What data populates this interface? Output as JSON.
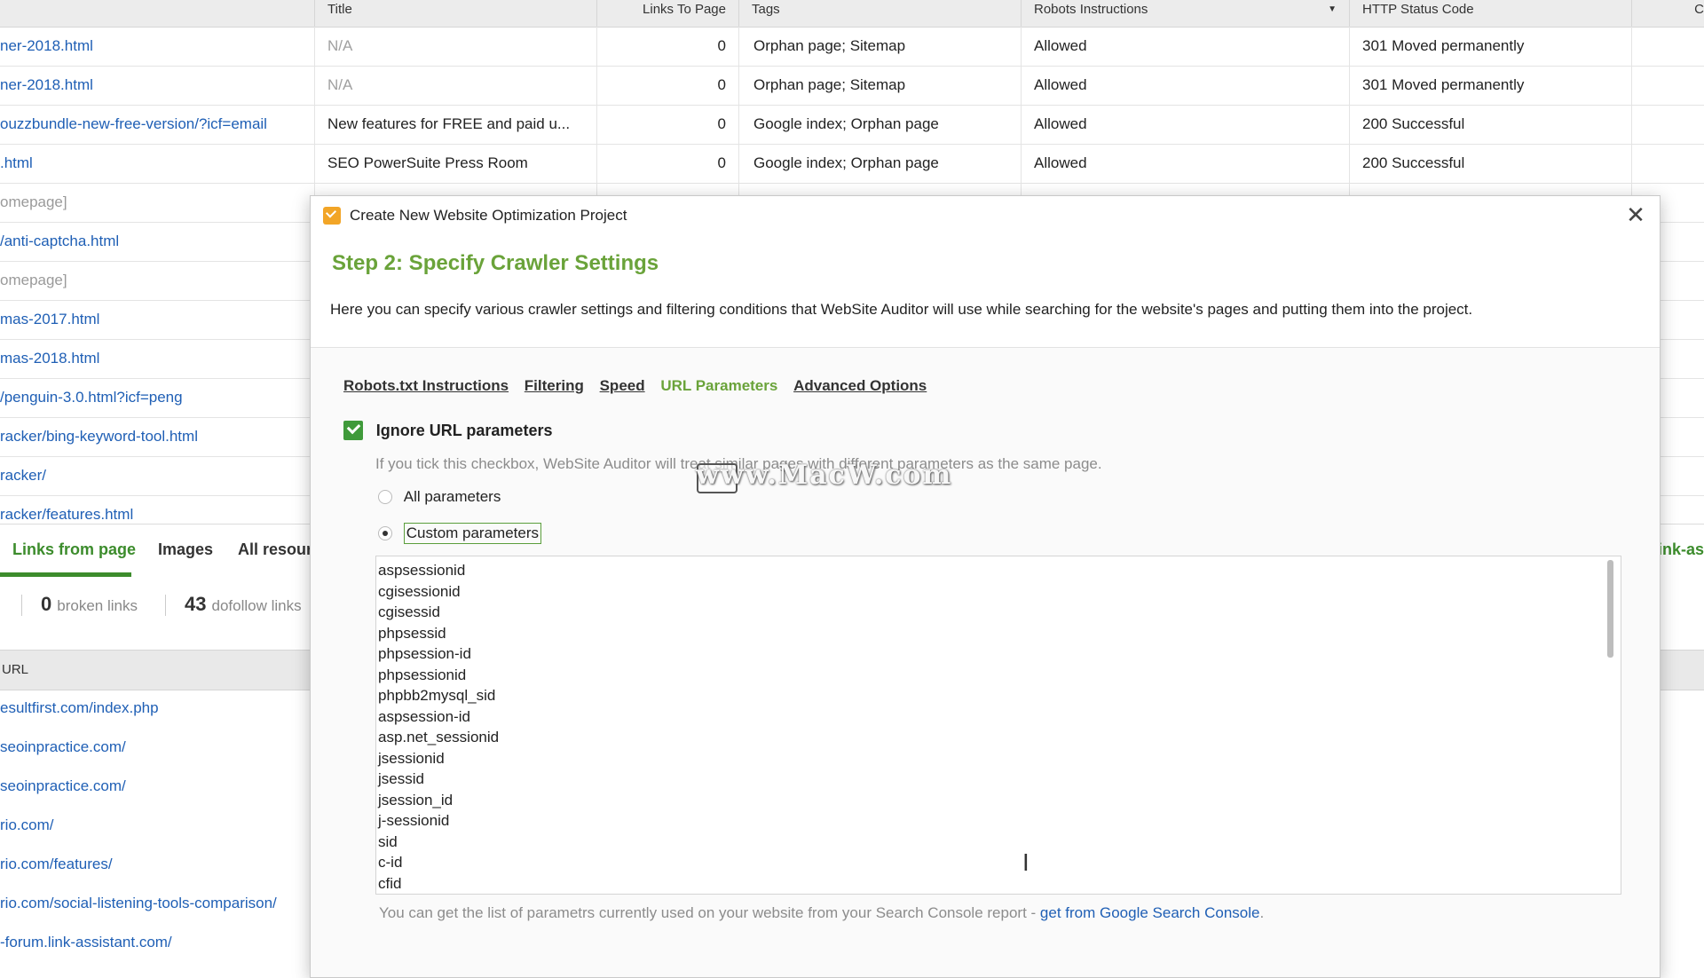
{
  "table": {
    "headers": {
      "title": "Title",
      "links": "Links To Page",
      "tags": "Tags",
      "robots": "Robots Instructions",
      "http": "HTTP Status Code",
      "more": "C"
    },
    "rows": [
      {
        "url": "ner-2018.html",
        "title": "N/A",
        "links": "0",
        "tags": "Orphan page; Sitemap",
        "robots": "Allowed",
        "http": "301 Moved permanently"
      },
      {
        "url": "ner-2018.html",
        "title": "N/A",
        "links": "0",
        "tags": "Orphan page; Sitemap",
        "robots": "Allowed",
        "http": "301 Moved permanently"
      },
      {
        "url": "ouzzbundle-new-free-version/?icf=email",
        "title": "New features for FREE and paid u...",
        "links": "0",
        "tags": "Google index; Orphan page",
        "robots": "Allowed",
        "http": "200 Successful"
      },
      {
        "url": ".html",
        "title": "SEO PowerSuite Press Room",
        "links": "0",
        "tags": "Google index; Orphan page",
        "robots": "Allowed",
        "http": "200 Successful"
      },
      {
        "url": "omepage]"
      },
      {
        "url": "/anti-captcha.html"
      },
      {
        "url": "omepage]"
      },
      {
        "url": "mas-2017.html"
      },
      {
        "url": "mas-2018.html"
      },
      {
        "url": "/penguin-3.0.html?icf=peng"
      },
      {
        "url": "racker/bing-keyword-tool.html"
      },
      {
        "url": "racker/"
      },
      {
        "url": "racker/features.html"
      }
    ]
  },
  "lower": {
    "tabs": [
      "Links from page",
      "Images",
      "All resour"
    ],
    "right_tab": "link-as",
    "stats": [
      {
        "num": "0",
        "label": "broken links"
      },
      {
        "num": "43",
        "label": "dofollow links"
      }
    ],
    "header_url": "URL",
    "rows": [
      "esultfirst.com/index.php",
      "seoinpractice.com/",
      "seoinpractice.com/",
      "rio.com/",
      "rio.com/features/",
      "rio.com/social-listening-tools-comparison/",
      "-forum.link-assistant.com/"
    ]
  },
  "modal": {
    "title": "Create New Website Optimization Project",
    "step": "Step 2: Specify Crawler Settings",
    "description": "Here you can specify various crawler settings and filtering conditions that WebSite Auditor will use while searching for the website's pages and putting them into the project.",
    "tabs": [
      {
        "label": "Robots.txt Instructions",
        "active": false
      },
      {
        "label": "Filtering",
        "active": false
      },
      {
        "label": "Speed",
        "active": false
      },
      {
        "label": "URL Parameters",
        "active": true
      },
      {
        "label": "Advanced Options",
        "active": false
      }
    ],
    "checkbox_label": "Ignore URL parameters",
    "checkbox_help": "If you tick this checkbox, WebSite Auditor will treat similar pages with different parameters as the same page.",
    "radio_all": "All parameters",
    "radio_custom": "Custom parameters",
    "params": [
      "aspsessionid",
      "cgisessionid",
      "cgisessid",
      "phpsessid",
      "phpsession-id",
      "phpsessionid",
      "phpbb2mysql_sid",
      "aspsession-id",
      "asp.net_sessionid",
      "jsessionid",
      "jsessid",
      "jsession_id",
      "j-sessionid",
      "sid",
      "c-id",
      "cfid"
    ],
    "footer_text": "You can get the list of parametrs currently used on your website from your Search Console report - ",
    "footer_link": "get from Google Search Console",
    "footer_end": "."
  },
  "watermark": "www.MacW.com"
}
